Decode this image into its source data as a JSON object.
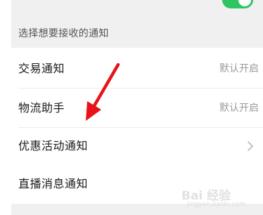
{
  "section": {
    "header": "选择想要接收的通知"
  },
  "rows": [
    {
      "label": "交易通知",
      "value": "默认开启"
    },
    {
      "label": "物流助手",
      "value": "默认开启"
    },
    {
      "label": "优惠活动通知",
      "value": ""
    },
    {
      "label": "直播消息通知",
      "value": ""
    }
  ],
  "toggle": {
    "state": "on"
  },
  "icons": {
    "chevron": "chevron-right-icon",
    "annotation": "red-arrow-annotation-icon"
  },
  "colors": {
    "accent_green": "#2fc464",
    "annotation_red": "#e8121a"
  },
  "watermark": {
    "brand": "Bai 经验",
    "url": "jingyan.baidu.com"
  }
}
